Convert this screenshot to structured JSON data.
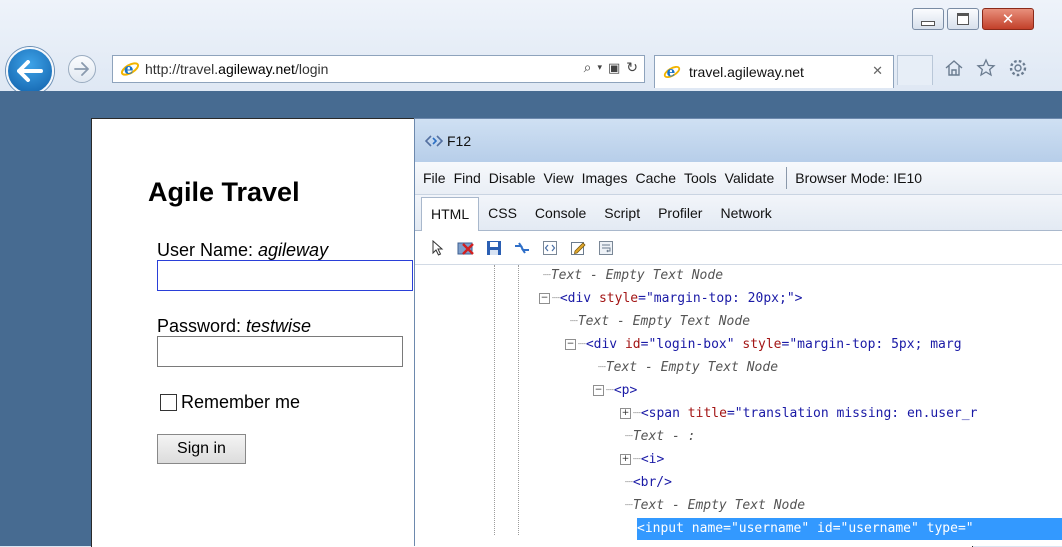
{
  "browser": {
    "address": {
      "url_prefix": "http://travel.",
      "url_domain": "agileway.net",
      "url_suffix": "/login"
    },
    "tab": {
      "title": "travel.agileway.net"
    },
    "window_buttons": [
      "minimize-icon",
      "maximize-icon",
      "close-icon"
    ],
    "toolbar_icons": [
      "home-icon",
      "favorites-star-icon",
      "gear-icon"
    ]
  },
  "page": {
    "title": "Agile Travel",
    "username_label": "User Name: ",
    "username_hint": "agileway",
    "password_label": "Password: ",
    "password_hint": "testwise",
    "remember_label": "Remember me",
    "signin_label": "Sign in"
  },
  "devtools": {
    "title": "F12",
    "menu": [
      "File",
      "Find",
      "Disable",
      "View",
      "Images",
      "Cache",
      "Tools",
      "Validate"
    ],
    "browser_mode": "Browser Mode: IE10",
    "tabs": [
      "HTML",
      "CSS",
      "Console",
      "Script",
      "Profiler",
      "Network"
    ],
    "active_tab": "HTML",
    "tree": [
      {
        "text": "Text - Empty Text Node"
      },
      {
        "open": "<div",
        "attr": " style",
        "eq": "=",
        "val": "\"margin-top: 20px;\"",
        "close": ">"
      },
      {
        "text": "Text - Empty Text Node"
      },
      {
        "open": "<div",
        "attr": " id",
        "eq": "=",
        "val": "\"login-box\"",
        "attr2": " style",
        "eq2": "=",
        "val2": "\"margin-top: 5px; marg",
        "close": ""
      },
      {
        "text": "Text - Empty Text Node"
      },
      {
        "open": "<p>"
      },
      {
        "open": "<span",
        "attr": " title",
        "eq": "=",
        "val": "\"translation missing: en.user_r",
        "close": ""
      },
      {
        "text": "Text - :"
      },
      {
        "open": "<i>"
      },
      {
        "open": "<br/>"
      },
      {
        "text": "Text - Empty Text Node"
      },
      {
        "open": "<input",
        "attr": " name",
        "eq": "=",
        "val": "\"username\"",
        "attr2": " id",
        "eq2": "=",
        "val2": "\"username\"",
        "attr3": " type",
        "eq3": "=",
        "val3": "\""
      }
    ]
  }
}
